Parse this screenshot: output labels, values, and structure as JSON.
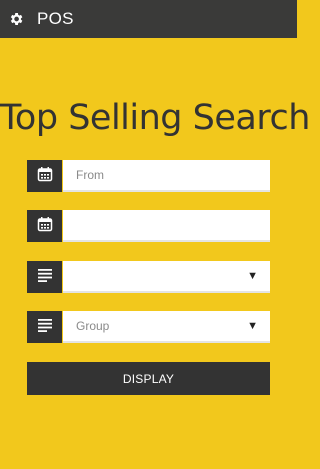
{
  "appbar": {
    "title": "POS",
    "icon": "gear-icon"
  },
  "page": {
    "heading": "Top Selling Search"
  },
  "form": {
    "from": {
      "placeholder": "From",
      "icon": "calendar-icon"
    },
    "to": {
      "placeholder": "",
      "icon": "calendar-icon"
    },
    "select1": {
      "value": "",
      "icon": "list-icon"
    },
    "group": {
      "value": "Group",
      "icon": "list-icon"
    },
    "display_label": "DISPLAY"
  },
  "colors": {
    "background": "#f2c81c",
    "appbar": "#3a3a39",
    "dark": "#333333"
  }
}
